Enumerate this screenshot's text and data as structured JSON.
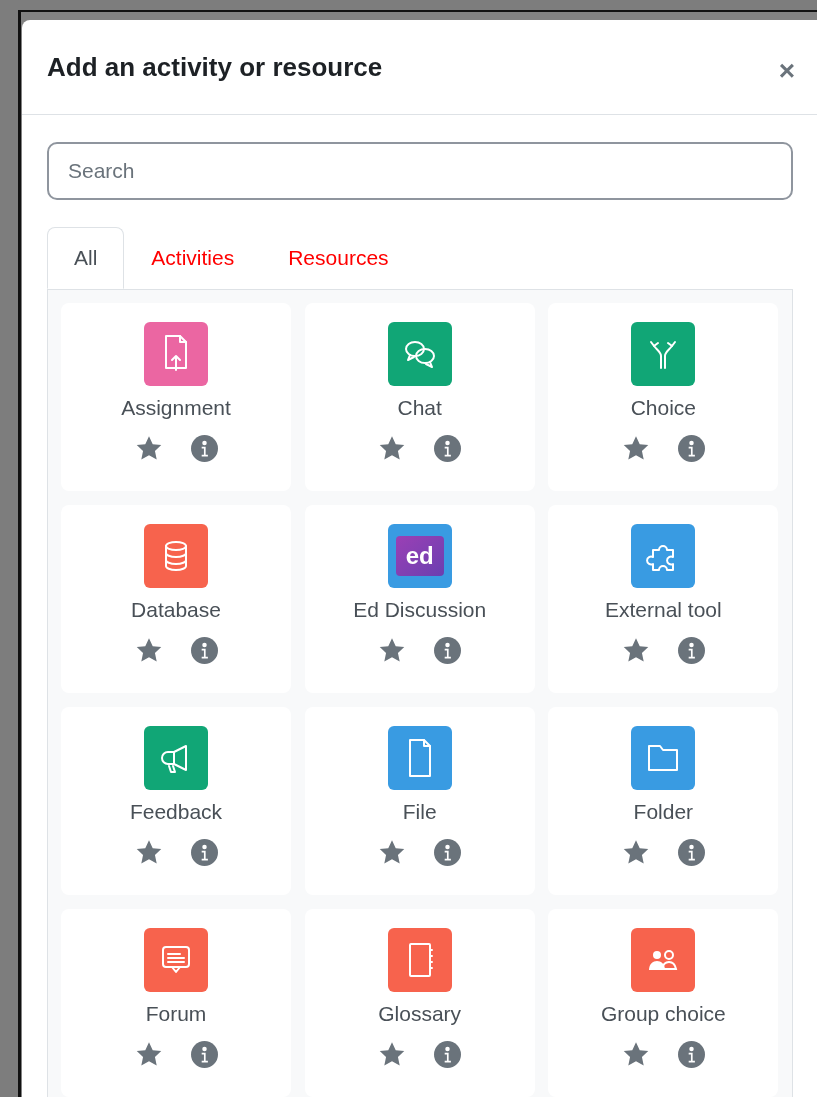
{
  "dialog": {
    "title": "Add an activity or resource",
    "close": "×"
  },
  "search": {
    "placeholder": "Search"
  },
  "tabs": [
    {
      "label": "All",
      "selected": true
    },
    {
      "label": "Activities",
      "selected": false
    },
    {
      "label": "Resources",
      "selected": false
    }
  ],
  "items": [
    {
      "label": "Assignment",
      "kind": "assignment",
      "color": "#eb66a2"
    },
    {
      "label": "Chat",
      "kind": "chat",
      "color": "#11a676"
    },
    {
      "label": "Choice",
      "kind": "choice",
      "color": "#11a676"
    },
    {
      "label": "Database",
      "kind": "database",
      "color": "#f7634d"
    },
    {
      "label": "Ed Discussion",
      "kind": "logo",
      "color": "#399be2"
    },
    {
      "label": "External tool",
      "kind": "puzzle",
      "color": "#399be2"
    },
    {
      "label": "Feedback",
      "kind": "feedback",
      "color": "#11a676"
    },
    {
      "label": "File",
      "kind": "file",
      "color": "#399be2"
    },
    {
      "label": "Folder",
      "kind": "folder",
      "color": "#399be2"
    },
    {
      "label": "Forum",
      "kind": "forum",
      "color": "#f7634d"
    },
    {
      "label": "Glossary",
      "kind": "glossary",
      "color": "#f7634d"
    },
    {
      "label": "Group choice",
      "kind": "group",
      "color": "#f7634d"
    }
  ],
  "logo_badge": {
    "text": "ed"
  }
}
